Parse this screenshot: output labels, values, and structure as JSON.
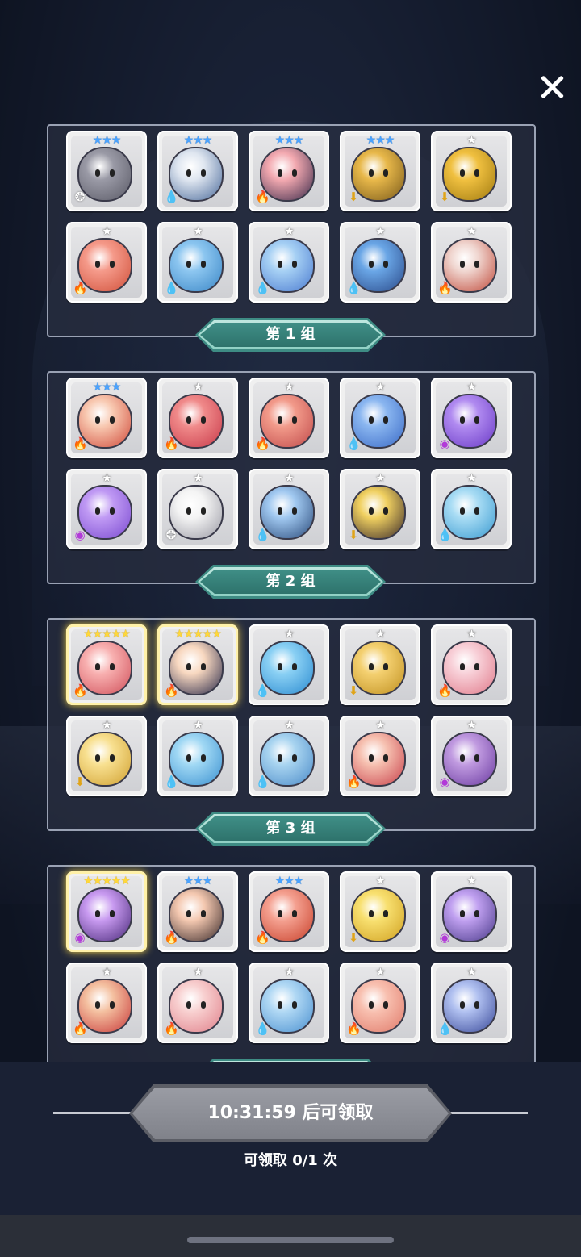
{
  "close_icon": "close-icon",
  "groups": [
    {
      "label": "第 1 组",
      "heroes": [
        {
          "stars": 3,
          "star_color": "blue",
          "element": "light",
          "c1": "#9a9aa6",
          "c2": "#5a5a66"
        },
        {
          "stars": 3,
          "star_color": "blue",
          "element": "water",
          "c1": "#dfe6f0",
          "c2": "#4a6a9a"
        },
        {
          "stars": 3,
          "star_color": "blue",
          "element": "fire",
          "c1": "#f3a9b0",
          "c2": "#3a2a4a"
        },
        {
          "stars": 3,
          "star_color": "blue",
          "element": "wind",
          "c1": "#e8b84a",
          "c2": "#7a5a1a"
        },
        {
          "stars": 1,
          "star_color": "white",
          "element": "wind",
          "c1": "#f0c040",
          "c2": "#a07a10"
        },
        {
          "stars": 1,
          "star_color": "white",
          "element": "fire",
          "c1": "#f59a8a",
          "c2": "#d0503a"
        },
        {
          "stars": 1,
          "star_color": "white",
          "element": "water",
          "c1": "#8cc6f0",
          "c2": "#3a86c6"
        },
        {
          "stars": 1,
          "star_color": "white",
          "element": "water",
          "c1": "#a6d0f4",
          "c2": "#4a7ad0"
        },
        {
          "stars": 1,
          "star_color": "white",
          "element": "water",
          "c1": "#6aa6e6",
          "c2": "#2a4a8a"
        },
        {
          "stars": 1,
          "star_color": "white",
          "element": "fire",
          "c1": "#f0d6d0",
          "c2": "#c04a3a"
        }
      ]
    },
    {
      "label": "第 2 组",
      "heroes": [
        {
          "stars": 3,
          "star_color": "blue",
          "element": "fire",
          "c1": "#f8c8b0",
          "c2": "#d04a3a"
        },
        {
          "stars": 1,
          "star_color": "white",
          "element": "fire",
          "c1": "#f08a8a",
          "c2": "#c83a4a"
        },
        {
          "stars": 1,
          "star_color": "white",
          "element": "fire",
          "c1": "#f29a8a",
          "c2": "#c04a4a"
        },
        {
          "stars": 1,
          "star_color": "white",
          "element": "water",
          "c1": "#8ab6f0",
          "c2": "#3a6ac6"
        },
        {
          "stars": 1,
          "star_color": "white",
          "element": "dark",
          "c1": "#b08af0",
          "c2": "#6a3ac6"
        },
        {
          "stars": 1,
          "star_color": "white",
          "element": "dark",
          "c1": "#c09af4",
          "c2": "#7a4ad0"
        },
        {
          "stars": 1,
          "star_color": "white",
          "element": "light",
          "c1": "#f4f4f4",
          "c2": "#9a9aa4"
        },
        {
          "stars": 1,
          "star_color": "white",
          "element": "water",
          "c1": "#a0c8f0",
          "c2": "#2a4a7a"
        },
        {
          "stars": 1,
          "star_color": "white",
          "element": "wind",
          "c1": "#f0d060",
          "c2": "#3a2a2a"
        },
        {
          "stars": 1,
          "star_color": "white",
          "element": "water",
          "c1": "#a8dcf4",
          "c2": "#3a9ad0"
        }
      ]
    },
    {
      "label": "第 3 组",
      "heroes": [
        {
          "stars": 5,
          "star_color": "gold",
          "element": "fire",
          "c1": "#f8b0b0",
          "c2": "#d0505a",
          "gold": true
        },
        {
          "stars": 5,
          "star_color": "gold",
          "element": "fire",
          "c1": "#f8d8c0",
          "c2": "#2a2a4a",
          "gold": true
        },
        {
          "stars": 1,
          "star_color": "white",
          "element": "water",
          "c1": "#8ad0f4",
          "c2": "#2a8ad0"
        },
        {
          "stars": 1,
          "star_color": "white",
          "element": "wind",
          "c1": "#f4d070",
          "c2": "#c09020"
        },
        {
          "stars": 1,
          "star_color": "white",
          "element": "fire",
          "c1": "#f8d0d8",
          "c2": "#e07a8a"
        },
        {
          "stars": 1,
          "star_color": "white",
          "element": "wind",
          "c1": "#f8e090",
          "c2": "#d0a030"
        },
        {
          "stars": 1,
          "star_color": "white",
          "element": "water",
          "c1": "#a0d8f4",
          "c2": "#3a90d0"
        },
        {
          "stars": 1,
          "star_color": "white",
          "element": "water",
          "c1": "#a8d4f0",
          "c2": "#4a8ac8"
        },
        {
          "stars": 1,
          "star_color": "white",
          "element": "fire",
          "c1": "#f6c0b0",
          "c2": "#c8404a"
        },
        {
          "stars": 1,
          "star_color": "white",
          "element": "dark",
          "c1": "#c09ae0",
          "c2": "#6a3aa0"
        }
      ]
    },
    {
      "label": "",
      "heroes": [
        {
          "stars": 5,
          "star_color": "gold",
          "element": "dark",
          "c1": "#c89af0",
          "c2": "#4a2a7a",
          "gold": true
        },
        {
          "stars": 3,
          "star_color": "blue",
          "element": "fire",
          "c1": "#f4c8b0",
          "c2": "#3a2a2a"
        },
        {
          "stars": 3,
          "star_color": "blue",
          "element": "fire",
          "c1": "#f4a090",
          "c2": "#c8402a"
        },
        {
          "stars": 1,
          "star_color": "white",
          "element": "wind",
          "c1": "#f8e070",
          "c2": "#d0a020"
        },
        {
          "stars": 1,
          "star_color": "white",
          "element": "dark",
          "c1": "#c0a0f0",
          "c2": "#4a3a8a"
        },
        {
          "stars": 1,
          "star_color": "white",
          "element": "fire",
          "c1": "#f4c0a0",
          "c2": "#c83a3a"
        },
        {
          "stars": 1,
          "star_color": "white",
          "element": "fire",
          "c1": "#f8d0d0",
          "c2": "#e0808a"
        },
        {
          "stars": 1,
          "star_color": "white",
          "element": "water",
          "c1": "#b0d8f4",
          "c2": "#4a90d0"
        },
        {
          "stars": 1,
          "star_color": "white",
          "element": "fire",
          "c1": "#f8c0b0",
          "c2": "#e07a6a"
        },
        {
          "stars": 1,
          "star_color": "white",
          "element": "water",
          "c1": "#b0c0f0",
          "c2": "#3a4a9a"
        }
      ]
    }
  ],
  "claim_button": {
    "label": "10:31:59 后可领取",
    "state": "disabled"
  },
  "claim_count_text": "可领取 0/1 次",
  "colors": {
    "ribbon": "#3e8c84",
    "button": "#80828a",
    "panel_border": "#9aa2b4"
  }
}
